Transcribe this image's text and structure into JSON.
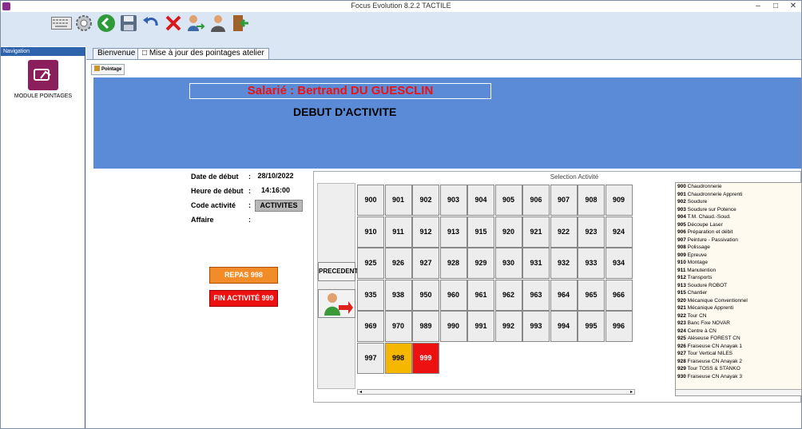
{
  "window": {
    "title": "Focus Evolution 8.2.2  TACTILE",
    "minimize": "–",
    "maximize": "□",
    "close": "✕"
  },
  "toolbar": {
    "buttons": [
      {
        "icon": "keyboard-icon"
      },
      {
        "icon": "gear-icon"
      },
      {
        "icon": "back-arrow-icon"
      },
      {
        "icon": "save-icon"
      },
      {
        "icon": "undo-icon"
      },
      {
        "icon": "delete-icon"
      },
      {
        "icon": "user-transfer-icon"
      },
      {
        "icon": "user-icon"
      },
      {
        "icon": "exit-door-icon"
      }
    ]
  },
  "navigation": {
    "header": "Navigation",
    "module_label": "MODULE POINTAGES"
  },
  "tabs": {
    "items": [
      "Bienvenue",
      "Mise à jour des pointages atelier"
    ],
    "active_index": 1
  },
  "subtab": {
    "label": "Pointage"
  },
  "employee": {
    "label": "Salarié : Bertrand  DU GUESCLIN"
  },
  "activity_title": "DEBUT D'ACTIVITE",
  "info": {
    "start_date_label": "Date de début",
    "start_date_value": "28/10/2022",
    "start_time_label": "Heure de début",
    "start_time_value": "14:16:00",
    "activity_code_label": "Code activité",
    "activity_code_value": "ACTIVITES",
    "affaire_label": "Affaire",
    "colon": ":"
  },
  "actions": {
    "repas_label": "REPAS  998",
    "fin_label": "FIN ACTIVITÉ 999"
  },
  "selection": {
    "title": "Selection Activité",
    "precedent_label": "PRECEDENT",
    "grid": [
      [
        "900",
        "901",
        "902",
        "903",
        "904",
        "905",
        "906",
        "907",
        "908",
        "909"
      ],
      [
        "910",
        "911",
        "912",
        "913",
        "915",
        "920",
        "921",
        "922",
        "923",
        "924"
      ],
      [
        "925",
        "926",
        "927",
        "928",
        "929",
        "930",
        "931",
        "932",
        "933",
        "934"
      ],
      [
        "935",
        "938",
        "950",
        "960",
        "961",
        "962",
        "963",
        "964",
        "965",
        "966"
      ],
      [
        "969",
        "970",
        "989",
        "990",
        "991",
        "992",
        "993",
        "994",
        "995",
        "996"
      ],
      [
        "997",
        "998",
        "999"
      ]
    ],
    "highlight": {
      "998": "#f5b700",
      "999": "#ee1111"
    }
  },
  "activity_list": [
    {
      "code": "900",
      "name": "Chaudronnerie"
    },
    {
      "code": "901",
      "name": "Chaudronnerie Apprenti"
    },
    {
      "code": "902",
      "name": "Soudure"
    },
    {
      "code": "903",
      "name": "Soudure sur Potence"
    },
    {
      "code": "904",
      "name": "T.M. Chaud.-Soud."
    },
    {
      "code": "905",
      "name": "Découpe Laser"
    },
    {
      "code": "906",
      "name": "Préparation et débit"
    },
    {
      "code": "907",
      "name": "Peinture - Passivation"
    },
    {
      "code": "908",
      "name": "Polissage"
    },
    {
      "code": "909",
      "name": "Epreuve"
    },
    {
      "code": "910",
      "name": "Montage"
    },
    {
      "code": "911",
      "name": "Manutention"
    },
    {
      "code": "912",
      "name": "Transports"
    },
    {
      "code": "913",
      "name": "Soudure ROBOT"
    },
    {
      "code": "915",
      "name": "Chantier"
    },
    {
      "code": "920",
      "name": "Mécanique Conventionnel"
    },
    {
      "code": "921",
      "name": "Mécanique Apprenti"
    },
    {
      "code": "922",
      "name": "Tour CN"
    },
    {
      "code": "923",
      "name": "Banc Fixe NOVAR"
    },
    {
      "code": "924",
      "name": "Centre à CN"
    },
    {
      "code": "925",
      "name": "Aléseuse FOREST CN"
    },
    {
      "code": "926",
      "name": "Fraiseuse CN Anayak 1"
    },
    {
      "code": "927",
      "name": "Tour Vertical NILES"
    },
    {
      "code": "928",
      "name": "Fraiseuse CN Anayak 2"
    },
    {
      "code": "929",
      "name": "Tour TOSS & STANKO"
    },
    {
      "code": "930",
      "name": "Fraiseuse CN Anayak 3"
    }
  ]
}
